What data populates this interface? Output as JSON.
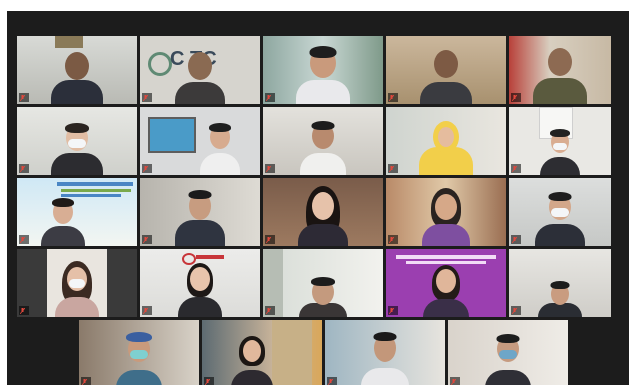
{
  "window": {
    "title": ""
  },
  "colors": {
    "speaker_highlight": "#a8d36a",
    "muted_mic": "#e2483d",
    "background": "#1c1c1c"
  },
  "meeting": {
    "tiles": [
      {
        "label": ""
      },
      {
        "label": "",
        "backdrop_text": "C TC"
      },
      {
        "label": ""
      },
      {
        "label": ""
      },
      {
        "label": ""
      },
      {
        "label": ""
      },
      {
        "label": ""
      },
      {
        "label": ""
      },
      {
        "label": ""
      },
      {
        "label": ""
      },
      {
        "label": ""
      },
      {
        "label": ""
      },
      {
        "label": ""
      },
      {
        "label": ""
      },
      {
        "label": ""
      },
      {
        "label": ""
      },
      {
        "label": ""
      },
      {
        "label": ""
      },
      {
        "label": ""
      },
      {
        "label": ""
      },
      {
        "label": ""
      },
      {
        "label": ""
      },
      {
        "label": ""
      },
      {
        "label": ""
      }
    ]
  }
}
